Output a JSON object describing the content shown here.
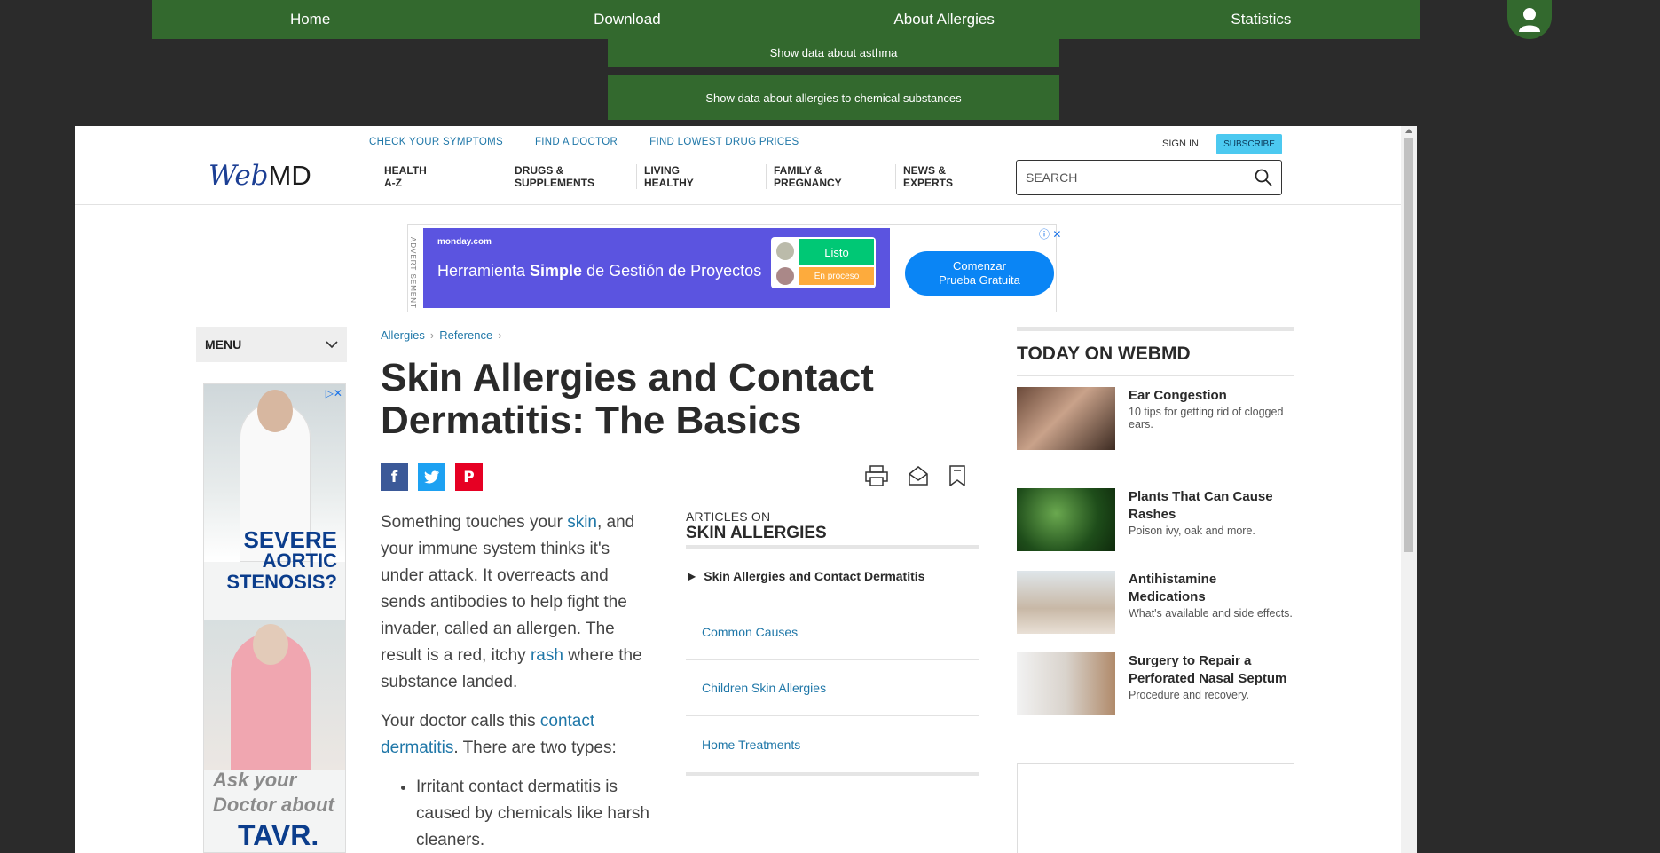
{
  "app_nav": {
    "items": [
      "Home",
      "Download",
      "About Allergies",
      "Statistics"
    ],
    "dropdown": [
      "Show data about asthma",
      "Show data about allergies to chemical substances"
    ]
  },
  "webmd": {
    "utility_links": [
      "CHECK YOUR SYMPTOMS",
      "FIND A DOCTOR",
      "FIND LOWEST DRUG PRICES"
    ],
    "sign_in": "SIGN IN",
    "subscribe": "SUBSCRIBE",
    "logo_a": "Web",
    "logo_b": "MD",
    "main_nav": [
      {
        "l1": "HEALTH",
        "l2": "A-Z"
      },
      {
        "l1": "DRUGS &",
        "l2": "SUPPLEMENTS"
      },
      {
        "l1": "LIVING",
        "l2": "HEALTHY"
      },
      {
        "l1": "FAMILY &",
        "l2": "PREGNANCY"
      },
      {
        "l1": "NEWS &",
        "l2": "EXPERTS"
      }
    ],
    "search_placeholder": "SEARCH"
  },
  "ad_banner": {
    "label": "ADVERTISEMENT",
    "brand": "monday.com",
    "headline_a": "Herramienta ",
    "headline_b": "Simple",
    "headline_c": " de Gestión de Proyectos",
    "status1": "Listo",
    "status2": "En proceso",
    "cta_l1": "Comenzar",
    "cta_l2": "Prueba Gratuita"
  },
  "left": {
    "menu": "MENU",
    "ad_severe": "SEVERE",
    "ad_aortic": "AORTIC",
    "ad_stenosis": "STENOSIS?",
    "ad_ask": "Ask your",
    "ad_doctor": "Doctor about",
    "ad_tavr": "TAVR."
  },
  "article": {
    "breadcrumbs": [
      "Allergies",
      "Reference"
    ],
    "title": "Skin Allergies and Contact Dermatitis: The Basics",
    "p1_a": "Something touches your ",
    "p1_link1": "skin",
    "p1_b": ", and your immune system thinks it's under attack. It overreacts and sends antibodies to help fight the invader, called an allergen. The result is a red, itchy ",
    "p1_link2": "rash",
    "p1_c": " where the substance landed.",
    "p2_a": "Your doctor calls this ",
    "p2_link": "contact dermatitis",
    "p2_b": ". There are two types:",
    "li1": "Irritant contact dermatitis is caused by chemicals like harsh cleaners."
  },
  "articles_on": {
    "label": "ARTICLES ON",
    "topic": "SKIN ALLERGIES",
    "items": [
      "Skin Allergies and Contact Dermatitis",
      "Common Causes",
      "Children Skin Allergies",
      "Home Treatments"
    ]
  },
  "today": {
    "heading": "TODAY ON WEBMD",
    "stories": [
      {
        "title": "Ear Congestion",
        "desc": "10 tips for getting rid of clogged ears."
      },
      {
        "title": "Plants That Can Cause Rashes",
        "desc": "Poison ivy, oak and more."
      },
      {
        "title": "Antihistamine Medications",
        "desc": "What's available and side effects."
      },
      {
        "title": "Surgery to Repair a Perforated Nasal Septum",
        "desc": "Procedure and recovery."
      }
    ]
  },
  "colors": {
    "app_green": "#33692e",
    "webmd_blue": "#1f77a8",
    "bg_dark": "#2b2b2b"
  }
}
